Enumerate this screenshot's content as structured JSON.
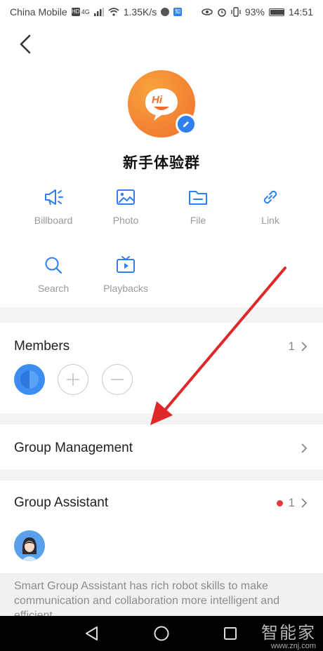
{
  "status_bar": {
    "carrier": "China Mobile",
    "speed": "1.35K/s",
    "battery": "93%",
    "battery_level": 0.93,
    "time": "14:51",
    "network": "4G"
  },
  "group": {
    "avatar_text": "Hi",
    "name": "新手体验群"
  },
  "functions": [
    {
      "label": "Billboard",
      "icon": "megaphone-icon"
    },
    {
      "label": "Photo",
      "icon": "image-icon"
    },
    {
      "label": "File",
      "icon": "folder-icon"
    },
    {
      "label": "Link",
      "icon": "link-icon"
    },
    {
      "label": "Search",
      "icon": "search-icon"
    },
    {
      "label": "Playbacks",
      "icon": "tv-playback-icon"
    }
  ],
  "members": {
    "title": "Members",
    "count": "1"
  },
  "group_management": {
    "title": "Group Management"
  },
  "group_assistant": {
    "title": "Group Assistant",
    "count": "1",
    "description": "Smart Group Assistant has rich robot skills to make communication and collaboration more intelligent and efficient."
  },
  "watermark": {
    "main": "智能家",
    "sub": "www.znj.com"
  },
  "colors": {
    "accent": "#2e7ff2",
    "avatar_orange": "#ef6f2d",
    "arrow_red": "#e0272a",
    "badge_red": "#e7393a"
  }
}
